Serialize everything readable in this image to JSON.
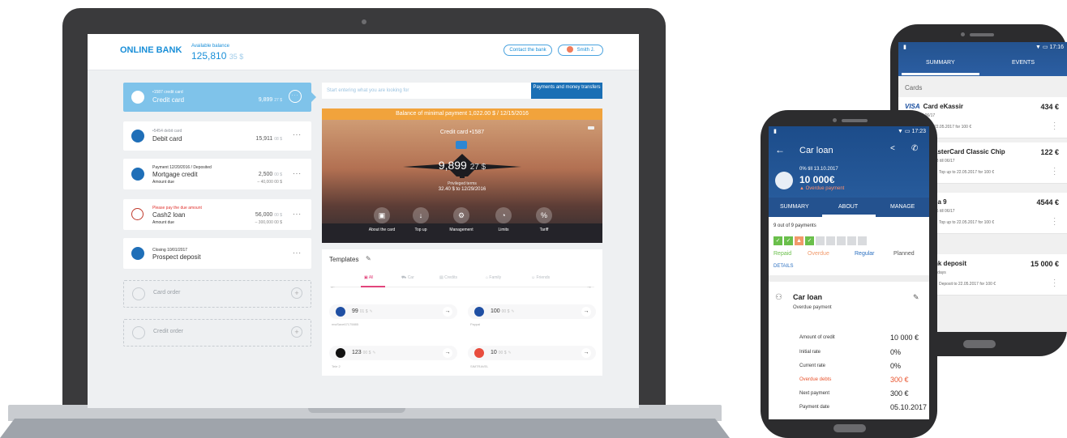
{
  "laptop": {
    "header": {
      "logo": "ONLINE BANK",
      "balance_label": "Available balance",
      "balance_main": "125,810",
      "balance_cents": "35 $",
      "contact_button": "Contact the bank",
      "user_name": "Smith J."
    },
    "cards": [
      {
        "small": "•1587 credit card",
        "name": "Credit card",
        "amount_main": "9,899",
        "amount_cents": "27 $",
        "sub": "",
        "sub_right": ""
      },
      {
        "small": "•5454 debit card",
        "name": "Debit card",
        "amount_main": "15,911",
        "amount_cents": "08 $",
        "sub": "",
        "sub_right": ""
      },
      {
        "small": "Payment 12/20/2016 / Deposited",
        "name": "Mortgage credit",
        "amount_main": "2,500",
        "amount_cents": "00 $",
        "sub": "Amount due",
        "sub_right": "– 40,000 00 $"
      },
      {
        "small": "Please pay the due amount",
        "name": "Cash2 loan",
        "amount_main": "56,000",
        "amount_cents": "00 $",
        "sub": "Amount due",
        "sub_right": "– 300,000 00 $"
      },
      {
        "small": "Closing 10/01/2017",
        "name": "Prospect deposit",
        "amount_main": "",
        "amount_cents": "",
        "sub": "",
        "sub_right": ""
      }
    ],
    "orders": [
      "Card order",
      "Credit order"
    ],
    "search_placeholder": "Start entering what you are looking for",
    "payments_button": "Payments and money transfers",
    "minimal_payment": "Balance of minimal payment 1,022.00 $ / 12/15/2016",
    "hero": {
      "title": "Credit card •1587",
      "amount_main": "9,899",
      "amount_cents": "27 $",
      "sub1": "Privileged terms",
      "sub2": "32.40 $ to 12/29/2016",
      "actions": [
        "About the card",
        "Top up",
        "Management",
        "Limits",
        "Tariff"
      ]
    },
    "templates": {
      "title": "Templates",
      "tabs": [
        "All",
        "Car",
        "Credits",
        "Family",
        "Friends"
      ],
      "items": [
        {
          "amount": "99",
          "cents": "01 $",
          "sub": "mwSave67175885"
        },
        {
          "amount": "100",
          "cents": "00 $",
          "sub": "Paypal"
        },
        {
          "amount": "123",
          "cents": "00 $",
          "sub": "Tele 2"
        },
        {
          "amount": "10",
          "cents": "00 $",
          "sub": "SIMTRAVEL"
        }
      ]
    }
  },
  "back_phone": {
    "time": "17:16",
    "tabs": [
      "SUMMARY",
      "EVENTS"
    ],
    "section": "Cards",
    "rows": [
      {
        "name": "Card eKassir",
        "sub": "4602 till 06/17",
        "amount": "434 €",
        "topup": "Top up to 22.05.2017 for 100 €"
      },
      {
        "name": "asterCard Classic Chip",
        "sub": "83 till 06/17",
        "amount": "122 €",
        "topup": "Top up to 22.05.2017 for 100 €"
      },
      {
        "name": "sa 9",
        "sub": "55 till 06/17",
        "amount": "4544 €",
        "topup": "Top up to 22.05.2017 for 100 €"
      },
      {
        "name": "nk deposit",
        "sub": "3 days",
        "amount": "15 000 €",
        "topup": "Deposit to 22.05.2017 for 100 €"
      }
    ]
  },
  "front_phone": {
    "time": "17:23",
    "title": "Car loan",
    "rate_line": "0% till 13.10.2017",
    "amount": "10 000€",
    "overdue": "Overdue payment",
    "tabs": [
      "SUMMARY",
      "ABOUT",
      "MANAGE"
    ],
    "payments_count": "9 out of 9 payments",
    "legend": {
      "repaid": "Repaid",
      "overdue": "Overdue",
      "regular": "Regular",
      "planned": "Planned"
    },
    "details": "DETAILS",
    "loan_title": "Car loan",
    "loan_sub": "Overdue payment",
    "rows": [
      {
        "k": "Amount of credit",
        "v": "10 000 €"
      },
      {
        "k": "Initial rate",
        "v": "0%"
      },
      {
        "k": "Current rate",
        "v": "0%"
      },
      {
        "k": "Overdue debts",
        "v": "300 €"
      },
      {
        "k": "Next payment",
        "v": "300 €"
      },
      {
        "k": "Payment date",
        "v": "05.10.2017"
      }
    ]
  },
  "colors": {
    "brand": "#1a8fd8",
    "accent_orange": "#f1a33c",
    "overdue_red": "#e8542e",
    "repaid_green": "#6abf4b"
  }
}
